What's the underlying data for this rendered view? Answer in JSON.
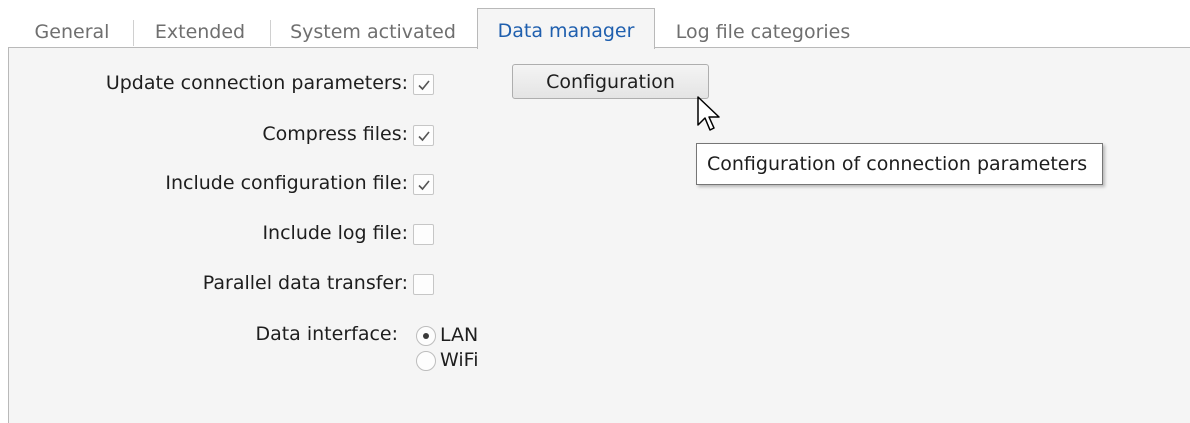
{
  "tabs": [
    {
      "label": "General",
      "active": false
    },
    {
      "label": "Extended",
      "active": false
    },
    {
      "label": "System activated",
      "active": false
    },
    {
      "label": "Data manager",
      "active": true
    },
    {
      "label": "Log file categories",
      "active": false
    }
  ],
  "settings": {
    "update_connection_parameters": {
      "label": "Update connection parameters:",
      "checked": true
    },
    "compress_files": {
      "label": "Compress files:",
      "checked": true
    },
    "include_configuration_file": {
      "label": "Include configuration file:",
      "checked": true
    },
    "include_log_file": {
      "label": "Include log file:",
      "checked": false
    },
    "parallel_data_transfer": {
      "label": "Parallel data transfer:",
      "checked": false
    },
    "data_interface": {
      "label": "Data interface:",
      "options": [
        "LAN",
        "WiFi"
      ],
      "selected": "LAN"
    }
  },
  "configuration_button": {
    "label": "Configuration"
  },
  "tooltip": {
    "text": "Configuration of connection parameters"
  },
  "colors": {
    "active_tab_text": "#1f5fae",
    "panel_background": "#f5f5f5"
  }
}
